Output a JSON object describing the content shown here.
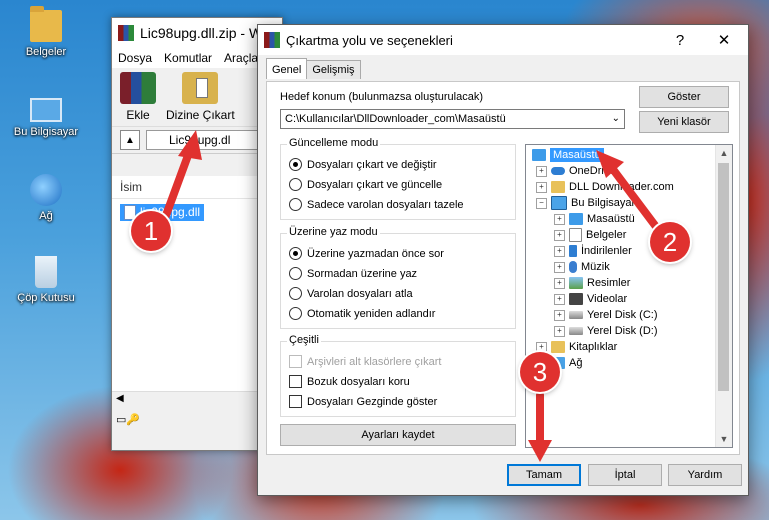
{
  "desktop": {
    "icons": [
      {
        "label": "Belgeler",
        "icon": "folder-icon"
      },
      {
        "label": "Bu Bilgisayar",
        "icon": "computer-icon"
      },
      {
        "label": "Ağ",
        "icon": "network-icon"
      },
      {
        "label": "Çöp Kutusu",
        "icon": "recycle-bin-icon"
      }
    ]
  },
  "winrar": {
    "title": "Lic98upg.dll.zip - W",
    "menu": [
      "Dosya",
      "Komutlar",
      "Araçla"
    ],
    "toolbar": {
      "add": "Ekle",
      "extract": "Dizine Çıkart"
    },
    "path": "Lic98upg.dl",
    "column_name": "İsim",
    "file": "lic98upg.dll"
  },
  "dialog": {
    "title": "Çıkartma yolu ve seçenekleri",
    "help": "?",
    "close": "✕",
    "tabs": [
      "Genel",
      "Gelişmiş"
    ],
    "dest_label": "Hedef konum (bulunmazsa oluşturulacak)",
    "dest_value": "C:\\Kullanıcılar\\DllDownloader_com\\Masaüstü",
    "show_button": "Göster",
    "new_folder_button": "Yeni klasör",
    "update_mode": {
      "title": "Güncelleme modu",
      "options": [
        "Dosyaları çıkart ve değiştir",
        "Dosyaları çıkart ve güncelle",
        "Sadece varolan dosyaları tazele"
      ],
      "selected": 0
    },
    "overwrite_mode": {
      "title": "Üzerine yaz modu",
      "options": [
        "Üzerine yazmadan önce sor",
        "Sormadan üzerine yaz",
        "Varolan dosyaları atla",
        "Otomatik yeniden adlandır"
      ],
      "selected": 0
    },
    "misc": {
      "title": "Çeşitli",
      "options": [
        "Arşivleri alt klasörlere çıkart",
        "Bozuk dosyaları koru",
        "Dosyaları Gezginde göster"
      ],
      "disabled": [
        true,
        false,
        false
      ]
    },
    "save_settings": "Ayarları kaydet",
    "tree": [
      {
        "label": "Masaüstü",
        "icon": "desktop-icon",
        "selected": true
      },
      {
        "label": "OneDrive",
        "icon": "onedrive-icon"
      },
      {
        "label": "DLL Downloader.com",
        "icon": "user-icon"
      },
      {
        "label": "Bu Bilgisayar",
        "icon": "computer-icon"
      },
      {
        "label": "Masaüstü",
        "icon": "desktop-icon"
      },
      {
        "label": "Belgeler",
        "icon": "documents-icon"
      },
      {
        "label": "İndirilenler",
        "icon": "downloads-icon"
      },
      {
        "label": "Müzik",
        "icon": "music-icon"
      },
      {
        "label": "Resimler",
        "icon": "pictures-icon"
      },
      {
        "label": "Videolar",
        "icon": "videos-icon"
      },
      {
        "label": "Yerel Disk (C:)",
        "icon": "disk-icon"
      },
      {
        "label": "Yerel Disk (D:)",
        "icon": "disk-icon"
      },
      {
        "label": "Kitaplıklar",
        "icon": "libraries-icon"
      },
      {
        "label": "Ağ",
        "icon": "network-icon"
      }
    ],
    "ok": "Tamam",
    "cancel": "İptal",
    "help_button": "Yardım"
  },
  "annotations": [
    "1",
    "2",
    "3"
  ],
  "colors": {
    "annotation": "#e0312f",
    "selection": "#3399ff",
    "accent": "#0078d7"
  }
}
